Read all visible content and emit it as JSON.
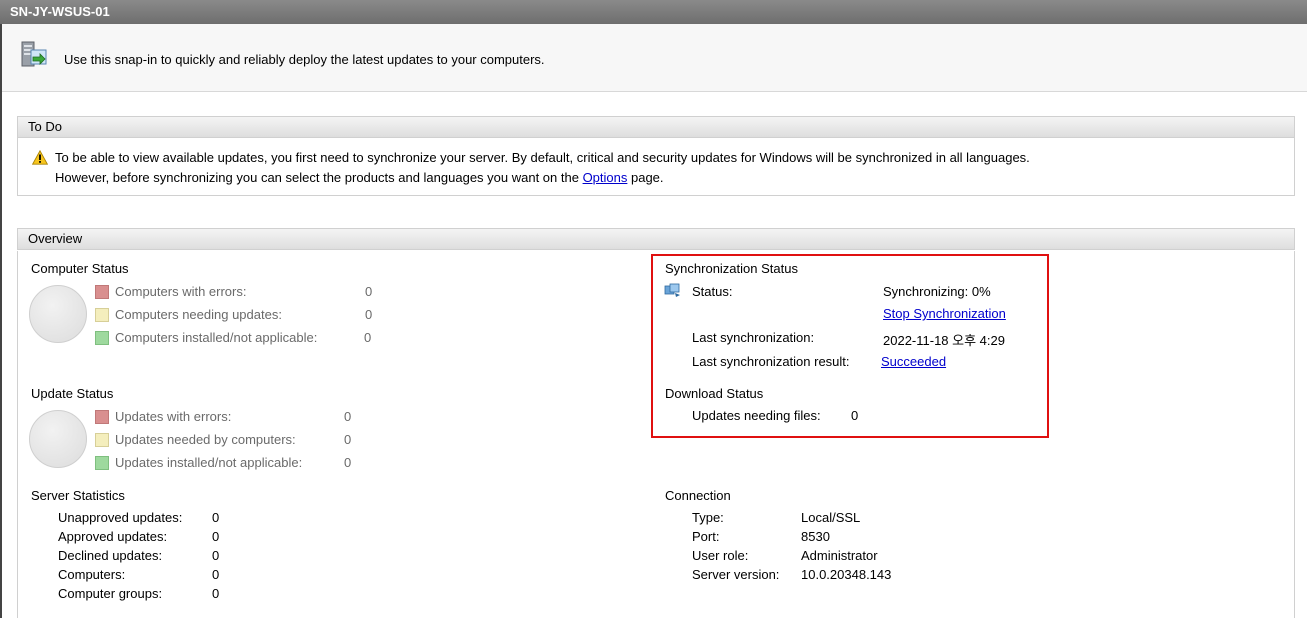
{
  "window": {
    "title": "SN-JY-WSUS-01"
  },
  "description": {
    "text": "Use this snap-in to quickly and reliably deploy the latest updates to your computers."
  },
  "todo": {
    "header": "To Do",
    "line1": "To be able to view available updates, you first need to synchronize your server. By default, critical and security updates for Windows will be synchronized in all languages.",
    "line2_prefix": "However, before synchronizing you can select the products and languages you want on the ",
    "options_link": "Options",
    "line2_suffix": " page."
  },
  "overview": {
    "header": "Overview",
    "computer_status": {
      "title": "Computer Status",
      "items": [
        {
          "label": "Computers with errors:",
          "value": "0"
        },
        {
          "label": "Computers needing updates:",
          "value": "0"
        },
        {
          "label": "Computers installed/not applicable:",
          "value": "0"
        }
      ]
    },
    "update_status": {
      "title": "Update Status",
      "items": [
        {
          "label": "Updates with errors:",
          "value": "0"
        },
        {
          "label": "Updates needed by computers:",
          "value": "0"
        },
        {
          "label": "Updates installed/not applicable:",
          "value": "0"
        }
      ]
    },
    "server_statistics": {
      "title": "Server Statistics",
      "items": [
        {
          "label": "Unapproved updates:",
          "value": "0"
        },
        {
          "label": "Approved updates:",
          "value": "0"
        },
        {
          "label": "Declined updates:",
          "value": "0"
        },
        {
          "label": "Computers:",
          "value": "0"
        },
        {
          "label": "Computer groups:",
          "value": "0"
        }
      ]
    },
    "sync_status": {
      "title": "Synchronization Status",
      "status_label": "Status:",
      "status_value": "Synchronizing: 0%",
      "stop_link": "Stop Synchronization",
      "last_sync_label": "Last synchronization:",
      "last_sync_value": "2022-11-18 오후 4:29",
      "last_result_label": "Last synchronization result:",
      "last_result_link": "Succeeded"
    },
    "download_status": {
      "title": "Download Status",
      "label": "Updates needing files:",
      "value": "0"
    },
    "connection": {
      "title": "Connection",
      "items": [
        {
          "label": "Type:",
          "value": "Local/SSL"
        },
        {
          "label": "Port:",
          "value": "8530"
        },
        {
          "label": "User role:",
          "value": "Administrator"
        },
        {
          "label": "Server version:",
          "value": "10.0.20348.143"
        }
      ]
    }
  },
  "colors": {
    "highlight_box": "#e01010",
    "error_swatch": "#d98f8f",
    "needed_swatch": "#f4eebd",
    "installed_swatch": "#9ed99e",
    "link": "#0000cc"
  },
  "icons": {
    "snapin": "wsus-server-icon",
    "warning": "warning-icon",
    "sync": "sync-icon"
  }
}
